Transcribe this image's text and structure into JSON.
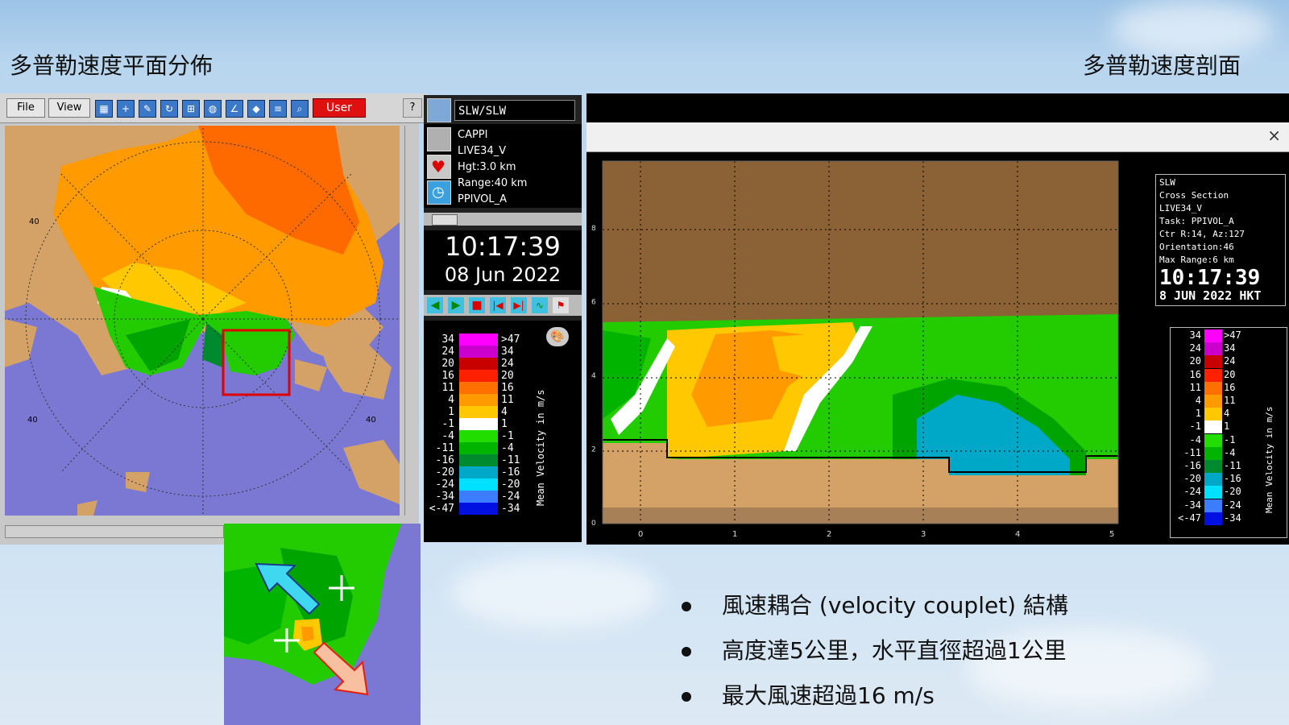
{
  "titles": {
    "left": "多普勒速度平面分佈",
    "right": "多普勒速度剖面"
  },
  "toolbar": {
    "file": "File",
    "view": "View",
    "user": "User",
    "help": "?",
    "icons": [
      "legend-icon",
      "crosshair-icon",
      "pen-icon",
      "refresh-icon",
      "zoom-icon",
      "globe-icon",
      "draw-icon",
      "layer-icon",
      "map-icon",
      "search-icon"
    ]
  },
  "map": {
    "ring_label": "40",
    "ring_label_bottom": "40",
    "ring_label_right": "40"
  },
  "info": {
    "station": "SLW/SLW",
    "product": "CAPPI",
    "task": "LIVE34_V",
    "height": "Hgt:3.0 km",
    "range": "Range:40 km",
    "volume": "PPIVOL_A",
    "time": "10:17:39",
    "date": "08 Jun 2022",
    "units": "Mean Velocity in m/s"
  },
  "legend": {
    "rows": [
      {
        "left": "34",
        "right": ">47",
        "color": "#ff00ff"
      },
      {
        "left": "24",
        "right": "34",
        "color": "#cc00cc"
      },
      {
        "left": "20",
        "right": "24",
        "color": "#c80000"
      },
      {
        "left": "16",
        "right": "20",
        "color": "#ff2000"
      },
      {
        "left": "11",
        "right": "16",
        "color": "#ff7000"
      },
      {
        "left": "4",
        "right": "11",
        "color": "#ff9a00"
      },
      {
        "left": "1",
        "right": "4",
        "color": "#ffc800"
      },
      {
        "left": "-1",
        "right": "1",
        "color": "#ffffff"
      },
      {
        "left": "-4",
        "right": "-1",
        "color": "#22dd00"
      },
      {
        "left": "-11",
        "right": "-4",
        "color": "#00b400"
      },
      {
        "left": "-16",
        "right": "-11",
        "color": "#008a30"
      },
      {
        "left": "-20",
        "right": "-16",
        "color": "#00a8c8"
      },
      {
        "left": "-24",
        "right": "-20",
        "color": "#00e0ff"
      },
      {
        "left": "-34",
        "right": "-24",
        "color": "#3c7cff"
      },
      {
        "left": "<-47",
        "right": "-34",
        "color": "#0010e0"
      }
    ]
  },
  "cross": {
    "close": "×",
    "info": [
      "SLW",
      "Cross Section",
      "LIVE34_V",
      "Task: PPIVOL_A",
      "Ctr R:14, Az:127",
      "Orientation:46",
      "Max Range:6 km"
    ],
    "time": "10:17:39",
    "date": "8 JUN 2022 HKT",
    "units": "Mean Velocity in m/s",
    "x_ticks": [
      "0",
      "1",
      "2",
      "3",
      "4",
      "5"
    ],
    "y_ticks": [
      "0",
      "2",
      "4",
      "6",
      "8"
    ]
  },
  "bullets": [
    "風速耦合 (velocity couplet) 結構",
    "高度達5公里，水平直徑超過1公里",
    "最大風速超過16 m/s"
  ]
}
